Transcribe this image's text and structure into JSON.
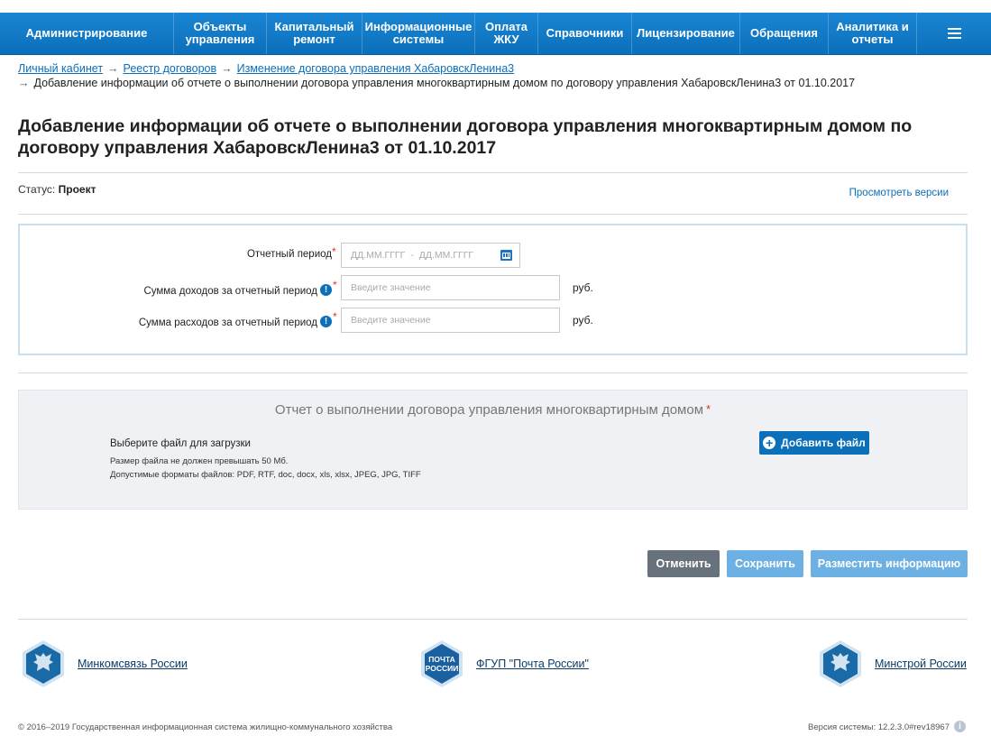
{
  "nav": {
    "items": [
      "Администрирование",
      "Объекты\nуправления",
      "Капитальный\nремонт",
      "Информационные\nсистемы",
      "Оплата\nЖКУ",
      "Справочники",
      "Лицензирование",
      "Обращения",
      "Аналитика и\nотчеты"
    ],
    "menu_icon": "hamburger-icon"
  },
  "breadcrumb": {
    "items": [
      "Личный кабинет",
      "Реестр договоров",
      "Изменение договора управления ХабаровскЛенина3"
    ],
    "current": "Добавление информации об отчете о выполнении договора управления многоквартирным домом по договору управления ХабаровскЛенина3 от 01.10.2017",
    "separator": "→"
  },
  "page": {
    "title": "Добавление информации об отчете о выполнении договора управления многоквартирным домом по договору управления ХабаровскЛенина3 от 01.10.2017",
    "status_label": "Статус:",
    "status_value": "Проект",
    "versions_link": "Просмотреть версии"
  },
  "form": {
    "period_label": "Отчетный период",
    "period_from_placeholder": "ДД.ММ.ГГГГ",
    "period_dash": "-",
    "period_to_placeholder": "ДД.ММ.ГГГГ",
    "income_label": "Сумма доходов за отчетный период",
    "income_placeholder": "Введите значение",
    "expense_label": "Сумма расходов за отчетный период",
    "expense_placeholder": "Введите значение",
    "currency": "руб.",
    "required_mark": "*",
    "info_mark": "!"
  },
  "upload": {
    "title": "Отчет о выполнении договора управления многоквартирным домом",
    "select_label": "Выберите файл для загрузки",
    "size_note": "Размер файла не должен превышать 50 Мб.",
    "formats_note": "Допустимые форматы файлов: PDF, RTF, doc, docx, xls, xlsx, JPEG, JPG, TIFF",
    "add_button": "Добавить файл",
    "add_icon": "+"
  },
  "actions": {
    "cancel": "Отменить",
    "save": "Сохранить",
    "post": "Разместить информацию"
  },
  "footer": {
    "links": [
      "Минкомсвязь России",
      "ФГУП \"Почта России\"",
      "Минстрой России"
    ],
    "pochta_logo_text": "ПОЧТА\nРОССИИ",
    "copyright": "© 2016–2019 Государственная информационная система жилищно-коммунального хозяйства",
    "version": "Версия системы: 12.2.3.0#rev18967",
    "version_icon": "i"
  },
  "colors": {
    "nav_blue": "#0d78c6",
    "link_blue": "#0b6fba",
    "required_red": "#d9342b",
    "cancel_gray": "#67727c",
    "disabled_blue": "#6db0e3"
  }
}
